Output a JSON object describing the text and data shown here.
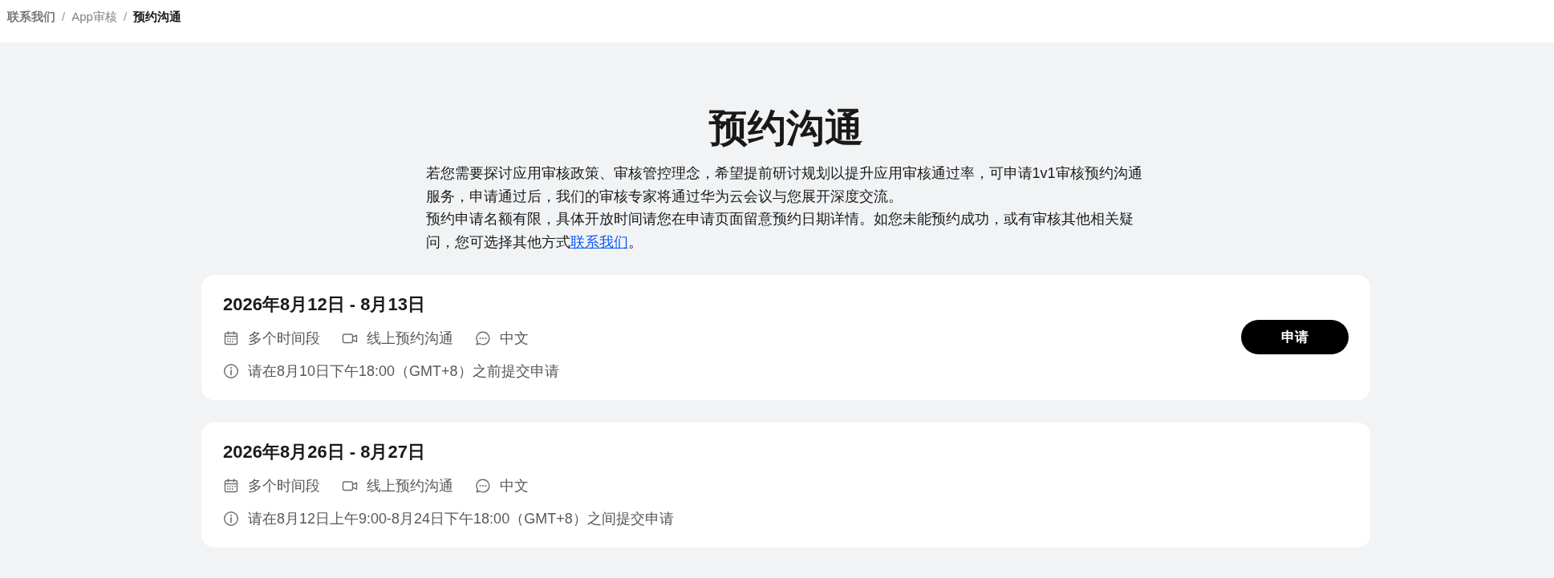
{
  "breadcrumb": [
    {
      "label": "联系我们",
      "kind": "root",
      "separator": "/"
    },
    {
      "label": "App审核",
      "kind": "link",
      "separator": "/"
    },
    {
      "label": "预约沟通",
      "kind": "current"
    }
  ],
  "page": {
    "title": "预约沟通",
    "intro": [
      {
        "text": "若您需要探讨应用审核政策、审核管控理念，希望提前研讨规划以提升应用审核通过率，可申请1v1审核预约沟通服务，申请通过后，我们的审核专家将通过华为云会议与您展开深度交流。"
      },
      {
        "text": "预约申请名额有限，具体开放时间请您在申请页面留意预约日期详情。如您未能预约成功，或有审核其他相关疑问，您可选择其他方式",
        "link": "联系我们",
        "after": "。"
      }
    ]
  },
  "sessions": [
    {
      "title": "2026年8月12日 - 8月13日",
      "features": [
        {
          "kind": "time",
          "label": "多个时间段"
        },
        {
          "kind": "mode",
          "label": "线上预约沟通"
        },
        {
          "kind": "language",
          "label": "中文"
        }
      ],
      "deadline": "请在8月10日下午18:00（GMT+8）之前提交申请",
      "button": "申请"
    },
    {
      "title": "2026年8月26日 - 8月27日",
      "features": [
        {
          "kind": "time",
          "label": "多个时间段"
        },
        {
          "kind": "mode",
          "label": "线上预约沟通"
        },
        {
          "kind": "language",
          "label": "中文"
        }
      ],
      "deadline": "请在8月12日上午9:00-8月24日下午18:00（GMT+8）之间提交申请"
    }
  ]
}
